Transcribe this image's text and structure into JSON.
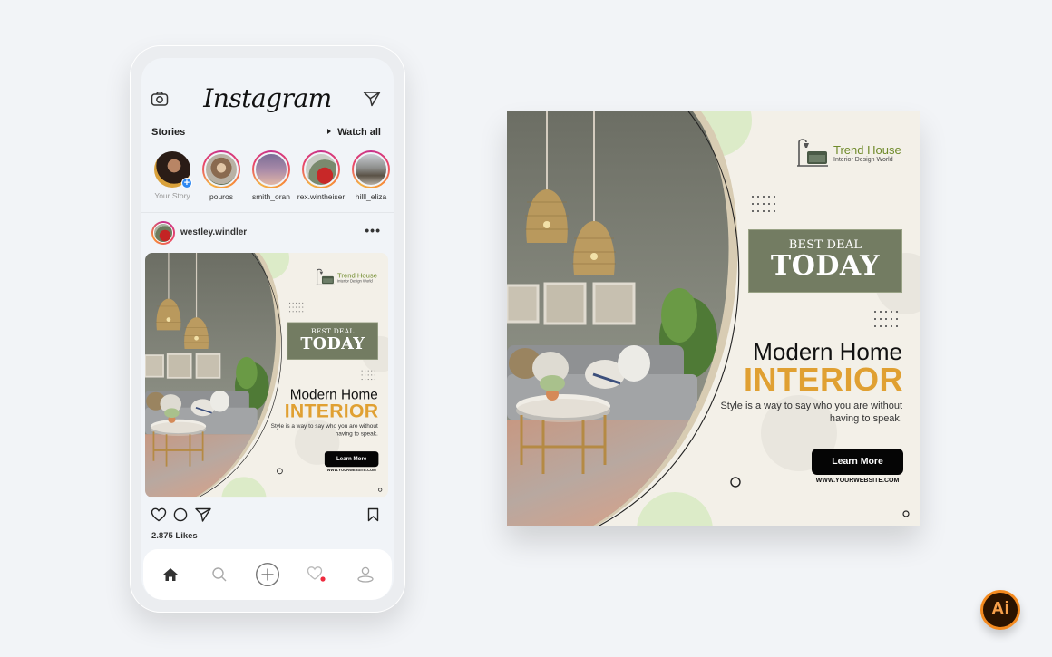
{
  "instagram": {
    "logo": "Instagram",
    "stories_label": "Stories",
    "watch_all_label": "Watch all",
    "stories": [
      {
        "name": "Your Story",
        "own": true
      },
      {
        "name": "pouros"
      },
      {
        "name": "smith_oran"
      },
      {
        "name": "rex.wintheiser"
      },
      {
        "name": "hilll_eliza"
      }
    ],
    "post": {
      "username": "westley.windler",
      "more_label": "•••",
      "likes": "2.875 Likes"
    },
    "bottom_nav": [
      {
        "icon": "home-icon",
        "active": true
      },
      {
        "icon": "search-icon"
      },
      {
        "icon": "add-post-icon"
      },
      {
        "icon": "activity-heart-icon",
        "notification": true
      },
      {
        "icon": "profile-icon"
      }
    ]
  },
  "ad": {
    "brand_name": "Trend House",
    "brand_tagline": "Interior Design World",
    "deal_line1": "BEST DEAL",
    "deal_line2": "TODAY",
    "title_line1": "Modern Home",
    "title_line2": "INTERIOR",
    "tagline": "Style is a way to say who you are without having to speak.",
    "cta_label": "Learn More",
    "website": "WWW.YOURWEBSITE.COM",
    "colors": {
      "accent_gold": "#e0a032",
      "deal_box": "#737c62",
      "brand_green": "#6f8a2a",
      "background": "#f3f0e8",
      "cta": "#050505"
    }
  },
  "badge": {
    "label": "Ai",
    "color": "#f48a1f"
  }
}
